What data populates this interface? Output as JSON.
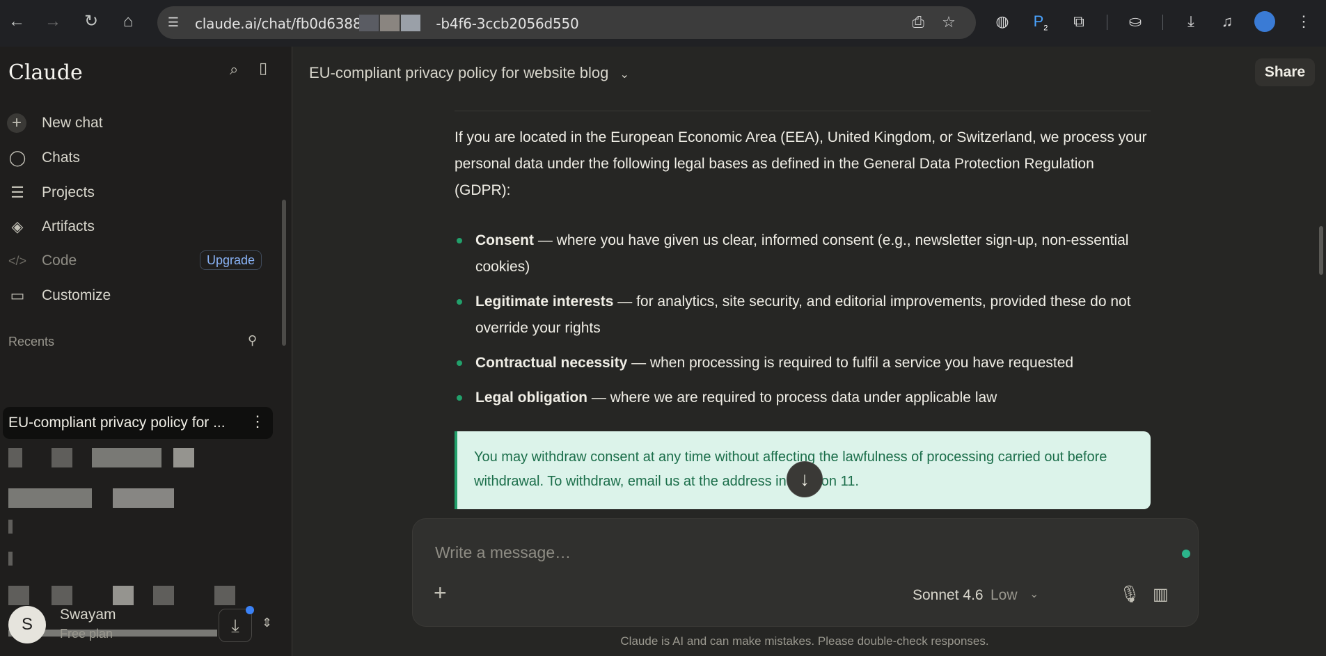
{
  "browser": {
    "url": "claude.ai/chat/fb0d6388-",
    "url_tail": "-b4f6-3ccb2056d550",
    "extension_badge": "2"
  },
  "sidebar": {
    "brand": "Claude",
    "nav": [
      {
        "label": "New chat",
        "icon": "plus-icon"
      },
      {
        "label": "Chats",
        "icon": "chat-bubble-icon"
      },
      {
        "label": "Projects",
        "icon": "folder-stack-icon"
      },
      {
        "label": "Artifacts",
        "icon": "shapes-icon"
      },
      {
        "label": "Code",
        "icon": "code-icon"
      },
      {
        "label": "Customize",
        "icon": "briefcase-icon"
      }
    ],
    "upgrade_label": "Upgrade",
    "recents_label": "Recents",
    "active_recent": "EU-compliant privacy policy for ...",
    "profile": {
      "initial": "S",
      "name": "Swayam",
      "plan": "Free plan"
    }
  },
  "main": {
    "title": "EU-compliant privacy policy for website blog",
    "share_label": "Share",
    "intro": "If you are located in the European Economic Area (EEA), United Kingdom, or Switzerland, we process your personal data under the following legal bases as defined in the General Data Protection Regulation (GDPR):",
    "bullets": [
      {
        "term": "Consent",
        "text": " — where you have given us clear, informed consent (e.g., newsletter sign-up, non-essential cookies)"
      },
      {
        "term": "Legitimate interests",
        "text": " — for analytics, site security, and editorial improvements, provided these do not override your rights"
      },
      {
        "term": "Contractual necessity",
        "text": " — when processing is required to fulfil a service you have requested"
      },
      {
        "term": "Legal obligation",
        "text": " — where we are required to process data under applicable law"
      }
    ],
    "callout": "You may withdraw consent at any time without affecting the lawfulness of processing carried out before withdrawal. To withdraw, email us at the address in Section 11.",
    "composer": {
      "placeholder": "Write a message…",
      "model": "Sonnet 4.6",
      "effort": "Low"
    },
    "disclaimer": "Claude is AI and can make mistakes. Please double-check responses."
  },
  "colors": {
    "accent_green": "#22a06b",
    "callout_bg": "#dcf3ea",
    "upgrade_blue": "#8ab4f8"
  }
}
